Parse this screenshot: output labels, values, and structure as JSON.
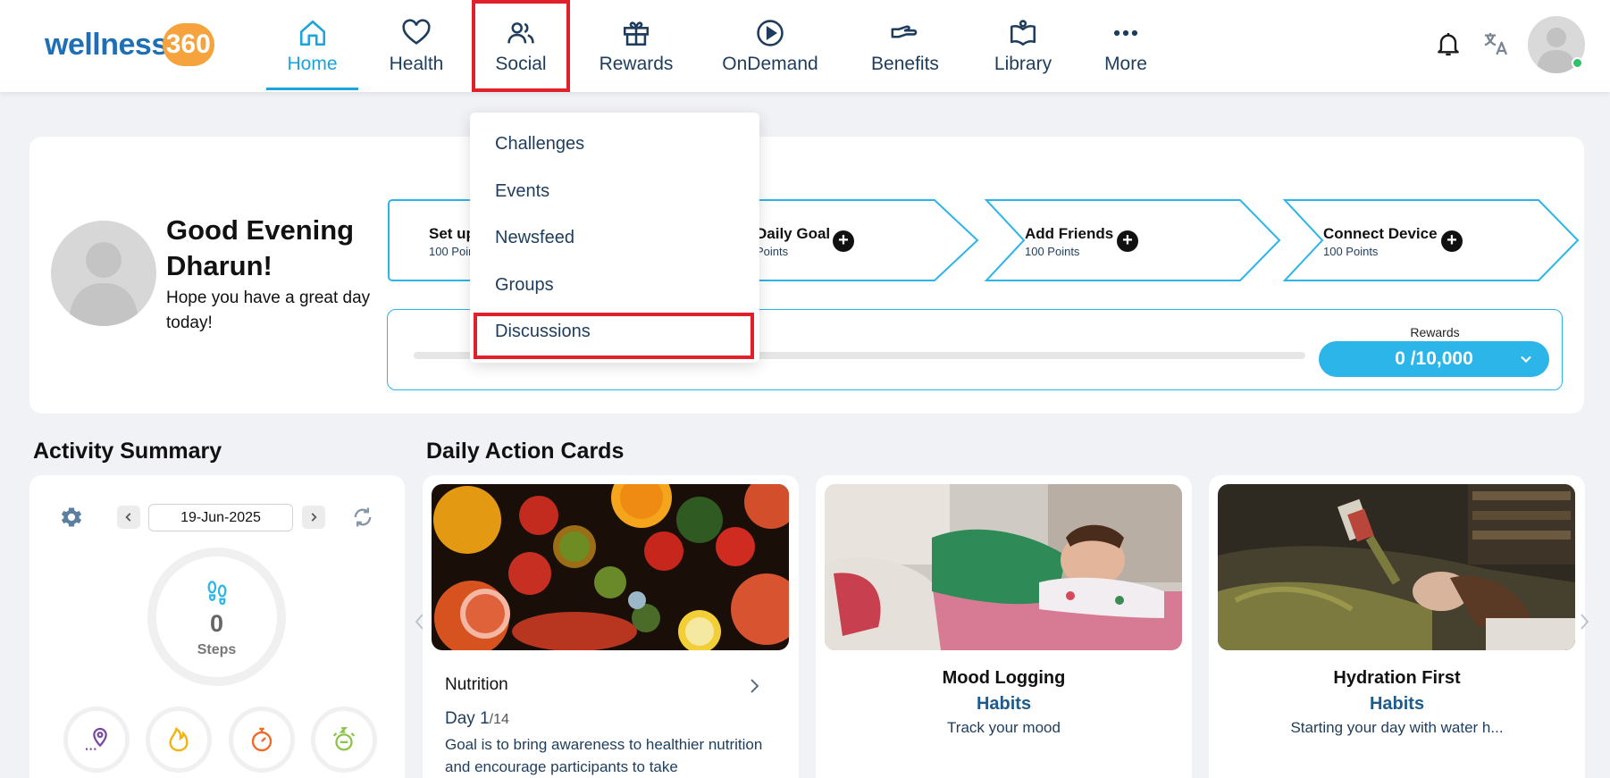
{
  "brand": {
    "logo_word": "wellness",
    "logo_number": "360",
    "primary": "#1f6fb5",
    "accent": "#1aa3dd",
    "badge": "#f7a33d",
    "highlight": "#e0212b"
  },
  "nav": [
    {
      "label": "Home",
      "icon": "home-icon",
      "active": true
    },
    {
      "label": "Health",
      "icon": "heart-icon"
    },
    {
      "label": "Social",
      "icon": "users-icon",
      "highlighted": true
    },
    {
      "label": "Rewards",
      "icon": "gift-icon"
    },
    {
      "label": "OnDemand",
      "icon": "play-circle-icon"
    },
    {
      "label": "Benefits",
      "icon": "hand-icon"
    },
    {
      "label": "Library",
      "icon": "book-icon"
    },
    {
      "label": "More",
      "icon": "more-dots-icon"
    }
  ],
  "header_icons": [
    "bell-icon",
    "translate-icon",
    "profile-avatar"
  ],
  "social_menu": {
    "items": [
      "Challenges",
      "Events",
      "Newsfeed",
      "Groups",
      "Discussions"
    ],
    "highlighted": "Discussions"
  },
  "welcome": {
    "greeting": "Good Evening Dharun!",
    "greeting_line1": "Good Evening",
    "greeting_line2": "Dharun!",
    "subtitle": "Hope you have a great day today!"
  },
  "onboarding_steps": [
    {
      "title": "Set up",
      "points": "100 Points"
    },
    {
      "title": "Daily Goal",
      "points": "Points"
    },
    {
      "title": "Add Friends",
      "points": "100 Points"
    },
    {
      "title": "Connect Device",
      "points": "100 Points"
    }
  ],
  "rewards": {
    "label": "Rewards",
    "value": "0 /10,000",
    "progress": 0
  },
  "activity": {
    "title": "Activity Summary",
    "date": "19-Jun-2025",
    "steps_value": "0",
    "steps_label": "Steps",
    "metrics": [
      "distance-icon",
      "flame-icon",
      "stopwatch-icon",
      "sleep-icon"
    ]
  },
  "daily_action": {
    "title": "Daily Action Cards",
    "cards": [
      {
        "title": "Nutrition",
        "day_label": "Day 1",
        "day_total": "/14",
        "description": "Goal is to bring awareness to healthier nutrition and encourage participants to take"
      },
      {
        "title": "Mood Logging",
        "category": "Habits",
        "description": "Track your mood"
      },
      {
        "title": "Hydration First",
        "category": "Habits",
        "description": "Starting your day with water h..."
      }
    ]
  }
}
